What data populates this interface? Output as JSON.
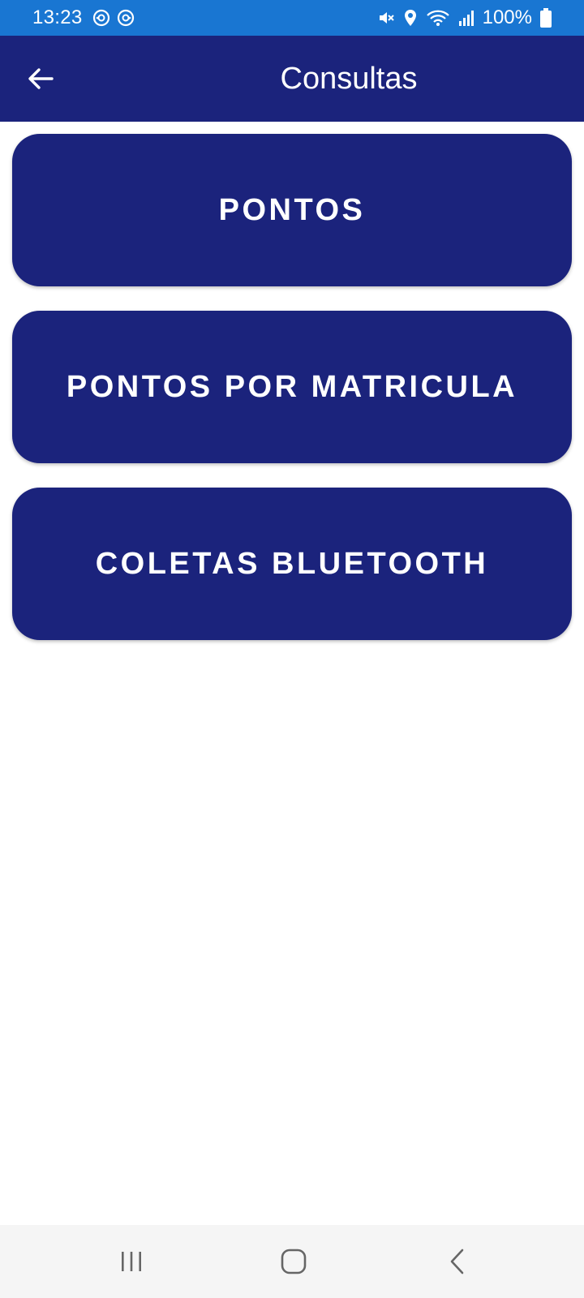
{
  "status_bar": {
    "time": "13:23",
    "battery": "100%",
    "left_icons": [
      "sync-icon",
      "sync-icon"
    ],
    "right_icons": [
      "mute-icon",
      "location-icon",
      "wifi-icon",
      "signal-icon",
      "battery-icon"
    ],
    "color": "#1976d2"
  },
  "app_bar": {
    "title": "Consultas",
    "back_icon": "arrow-left-icon",
    "color": "#1b237c"
  },
  "menu": {
    "items": [
      {
        "label": "PONTOS"
      },
      {
        "label": "PONTOS POR MATRICULA"
      },
      {
        "label": "COLETAS BLUETOOTH"
      }
    ],
    "button_color": "#1b237c"
  },
  "nav_bar": {
    "items": [
      "recents-icon",
      "home-icon",
      "back-icon"
    ]
  }
}
